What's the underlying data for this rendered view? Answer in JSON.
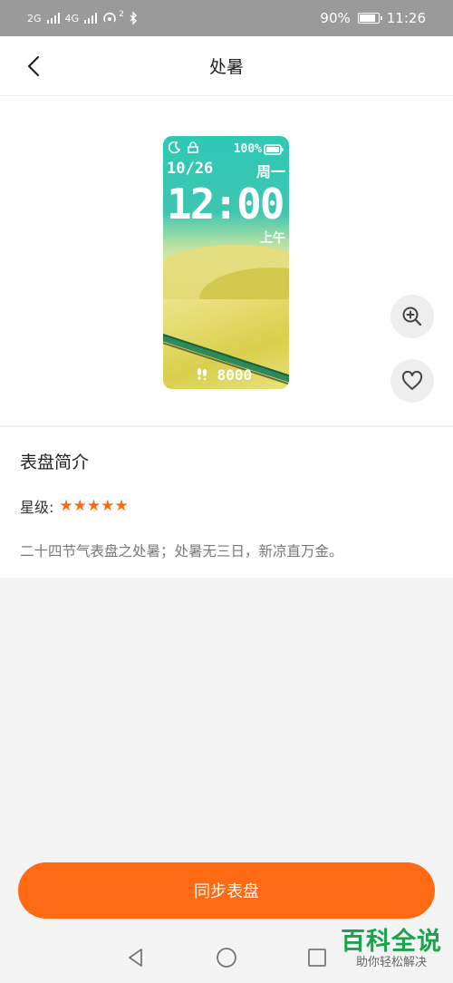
{
  "status_bar": {
    "signal1": "2G",
    "signal2": "4G",
    "hotspot_count": "2",
    "battery": "90%",
    "time": "11:26"
  },
  "header": {
    "title": "处暑"
  },
  "watch_preview": {
    "battery": "100%",
    "date": "10/26",
    "weekday": "周一",
    "time": "12:00",
    "ampm": "上午",
    "steps": "8000"
  },
  "info": {
    "heading": "表盘简介",
    "rating_label": "星级:",
    "stars": "★★★★★",
    "rating_value": 5,
    "rating_max": 5,
    "description": "二十四节气表盘之处暑；处暑无三日，新凉直万金。"
  },
  "actions": {
    "sync_label": "同步表盘"
  },
  "watermark": {
    "main": "百科全说",
    "sub": "助你轻松解决"
  },
  "colors": {
    "accent": "#ff6a13",
    "status_bar": "#9a9a9a",
    "watermark": "#1aa34a"
  }
}
